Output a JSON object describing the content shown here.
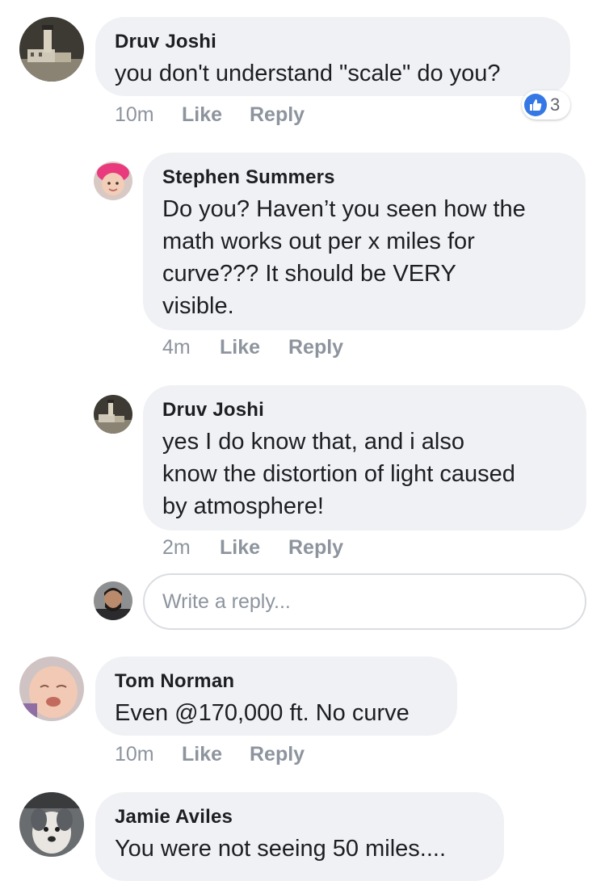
{
  "comments": [
    {
      "author": "Druv Joshi",
      "lines": [
        "you don't understand \"scale\" do you?"
      ],
      "time": "10m",
      "like_label": "Like",
      "reply_label": "Reply",
      "reaction": {
        "icon": "thumbs-up-icon",
        "count": "3"
      }
    },
    {
      "author": "Stephen Summers",
      "lines": [
        "Do you? Haven’t you seen how the",
        "math works out per x miles for",
        "curve??? It should be VERY",
        "visible."
      ],
      "time": "4m",
      "like_label": "Like",
      "reply_label": "Reply"
    },
    {
      "author": "Druv Joshi",
      "lines": [
        "yes I do know that, and i also",
        "know the distortion of light caused",
        "by atmosphere!"
      ],
      "time": "2m",
      "like_label": "Like",
      "reply_label": "Reply"
    },
    {
      "author": "Tom Norman",
      "lines": [
        "Even @170,000 ft. No curve"
      ],
      "time": "10m",
      "like_label": "Like",
      "reply_label": "Reply"
    },
    {
      "author": "Jamie Aviles",
      "lines": [
        "You were not seeing 50 miles...."
      ]
    }
  ],
  "reply_box": {
    "placeholder": "Write a reply..."
  },
  "colors": {
    "bubble": "#f0f1f4",
    "meta_text": "#8d949e",
    "like_blue": "#3578e5"
  }
}
